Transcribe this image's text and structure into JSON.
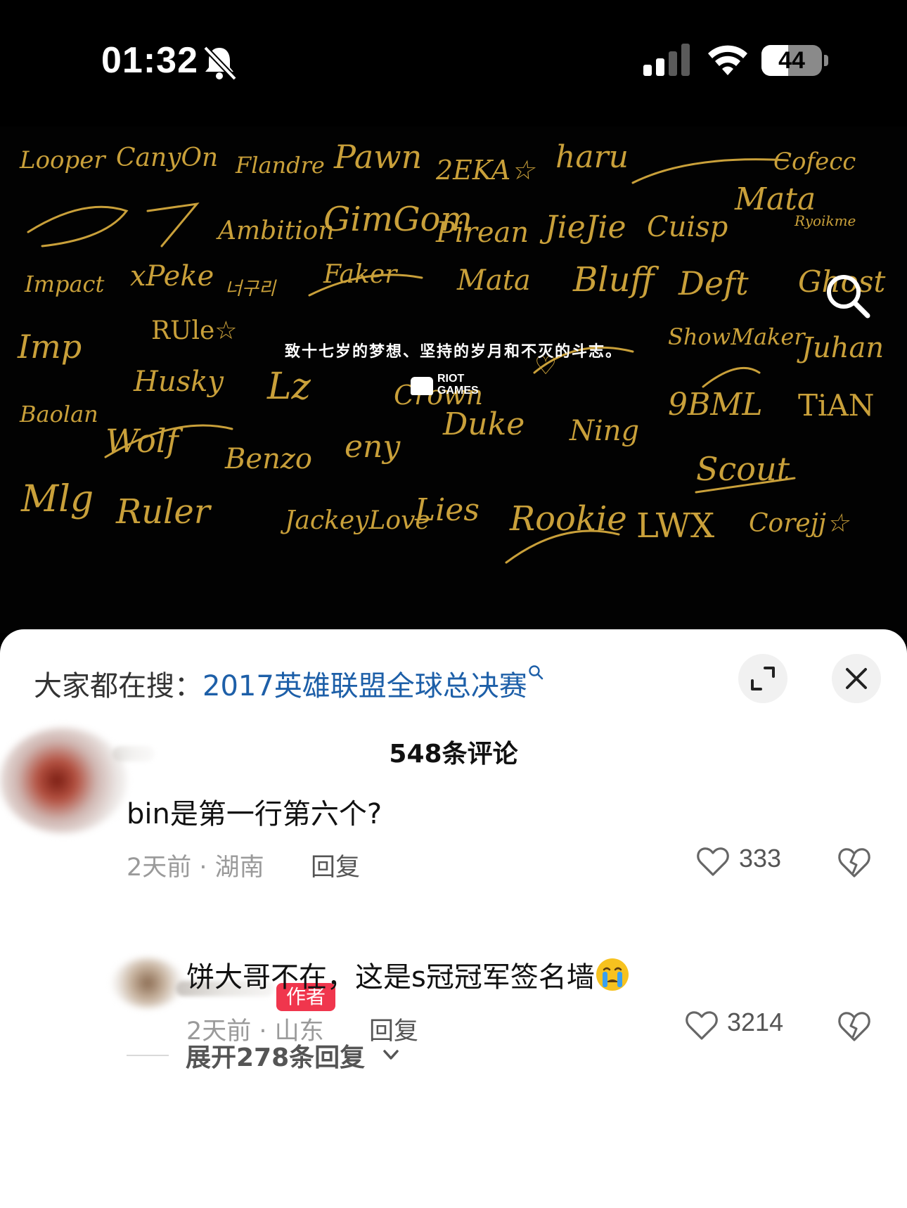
{
  "status_bar": {
    "time": "01:32",
    "battery": "44",
    "battery_fraction": 0.44
  },
  "poster": {
    "caption": "致十七岁的梦想、坚持的岁月和不灭的斗志。",
    "riot_logo_text": "RIOT\nGAMES"
  },
  "sheet": {
    "search_prefix": "大家都在搜：",
    "search_term": "2017英雄联盟全球总决赛",
    "comment_count": "548条评论"
  },
  "comments": [
    {
      "text": "bin是第一行第六个?",
      "meta": "2天前 · 湖南",
      "reply": "回复",
      "likes": "333"
    },
    {
      "badge": "作者",
      "text": "饼大哥不在，这是s冠冠军签名墙",
      "meta": "2天前 · 山东",
      "reply": "回复",
      "likes": "3214"
    }
  ],
  "expand_replies": "展开278条回复",
  "colors": {
    "gold": "#c9a03a",
    "link_blue": "#1d5fa8",
    "author_badge": "#f0364d"
  }
}
